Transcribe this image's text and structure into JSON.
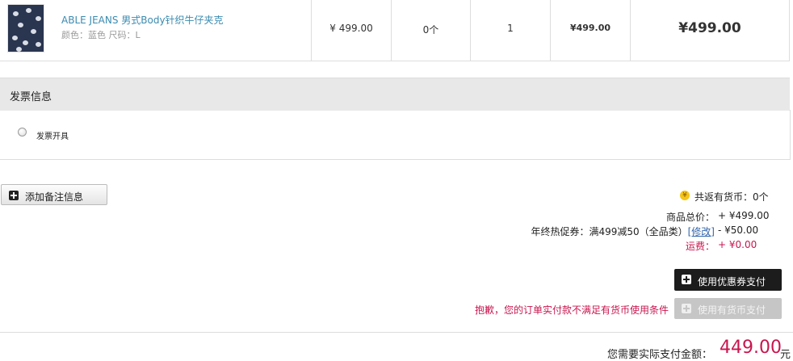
{
  "product": {
    "name": "ABLE JEANS 男式Body针织牛仔夹克",
    "attributes": "颜色：蓝色 尺码：L",
    "unit_price": "¥ 499.00",
    "coins": "0个",
    "quantity": "1",
    "subtotal": "¥499.00",
    "total": "¥499.00"
  },
  "invoice": {
    "title": "发票信息",
    "option_label": "发票开具"
  },
  "notes": {
    "add_button_label": "添加备注信息"
  },
  "summary": {
    "coin_icon": "coin-icon",
    "coins_return": "共返有货币：0个",
    "goods_total_label": "商品总价：",
    "goods_total_value": "+ ¥499.00",
    "promo_label_prefix": "年终热促券：满499减50（全品类）",
    "promo_modify": "[修改]",
    "promo_value": "- ¥50.00",
    "shipping_label": "运费：",
    "shipping_value": "+ ¥0.00"
  },
  "actions": {
    "coupon_pay_label": "使用优惠券支付",
    "coin_pay_label": "使用有货币支付",
    "coin_warning": "抱歉，您的订单实付款不满足有货币使用条件"
  },
  "payable": {
    "label": "您需要实际支付金额：",
    "amount": "449.00",
    "unit": "元"
  },
  "colors": {
    "accent_red": "#c8164f",
    "link_blue": "#3a8bb0",
    "dark_button": "#1c1c1c",
    "disabled_button": "#c6c6c6"
  }
}
